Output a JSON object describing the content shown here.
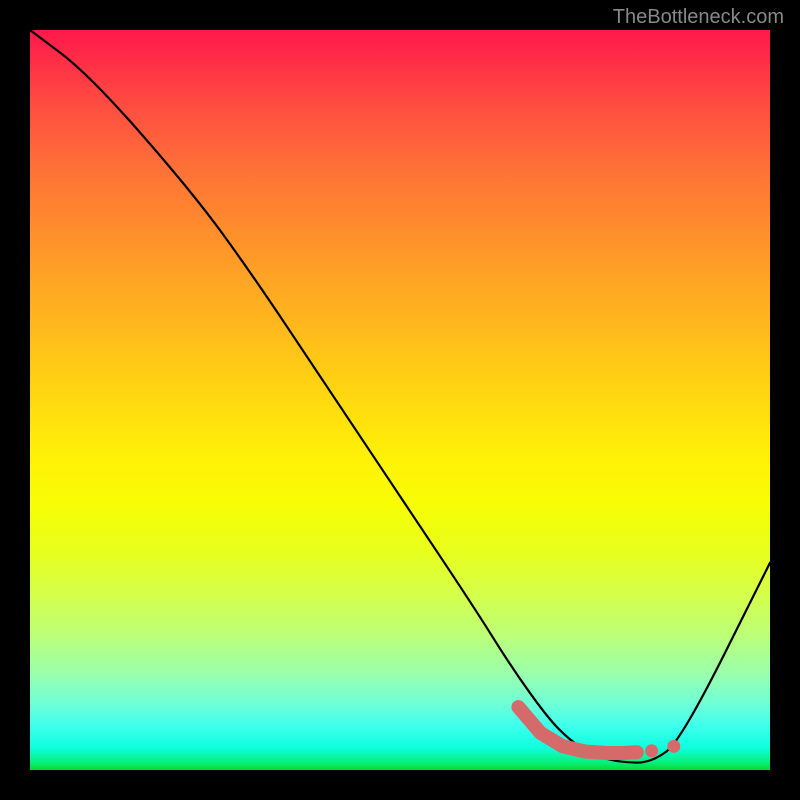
{
  "watermark": "TheBottleneck.com",
  "chart_data": {
    "type": "line",
    "title": "",
    "xlabel": "",
    "ylabel": "",
    "xlim": [
      0,
      100
    ],
    "ylim": [
      0,
      100
    ],
    "series": [
      {
        "name": "main-curve",
        "x": [
          0,
          8,
          22,
          30,
          40,
          50,
          60,
          65,
          70,
          73,
          76,
          80,
          84,
          88,
          100
        ],
        "y": [
          100,
          94,
          78,
          67,
          52,
          37,
          22,
          14,
          7,
          4,
          2,
          1,
          1,
          4,
          28
        ]
      }
    ],
    "highlight": {
      "name": "highlight-segment",
      "color": "#d46a6a",
      "x": [
        66,
        69,
        72,
        75,
        78,
        80,
        82
      ],
      "y": [
        8.5,
        5.0,
        3.2,
        2.5,
        2.3,
        2.3,
        2.4
      ]
    },
    "highlight_dots": {
      "color": "#d46a6a",
      "points": [
        {
          "x": 84,
          "y": 2.6
        },
        {
          "x": 87,
          "y": 3.2
        }
      ]
    }
  }
}
